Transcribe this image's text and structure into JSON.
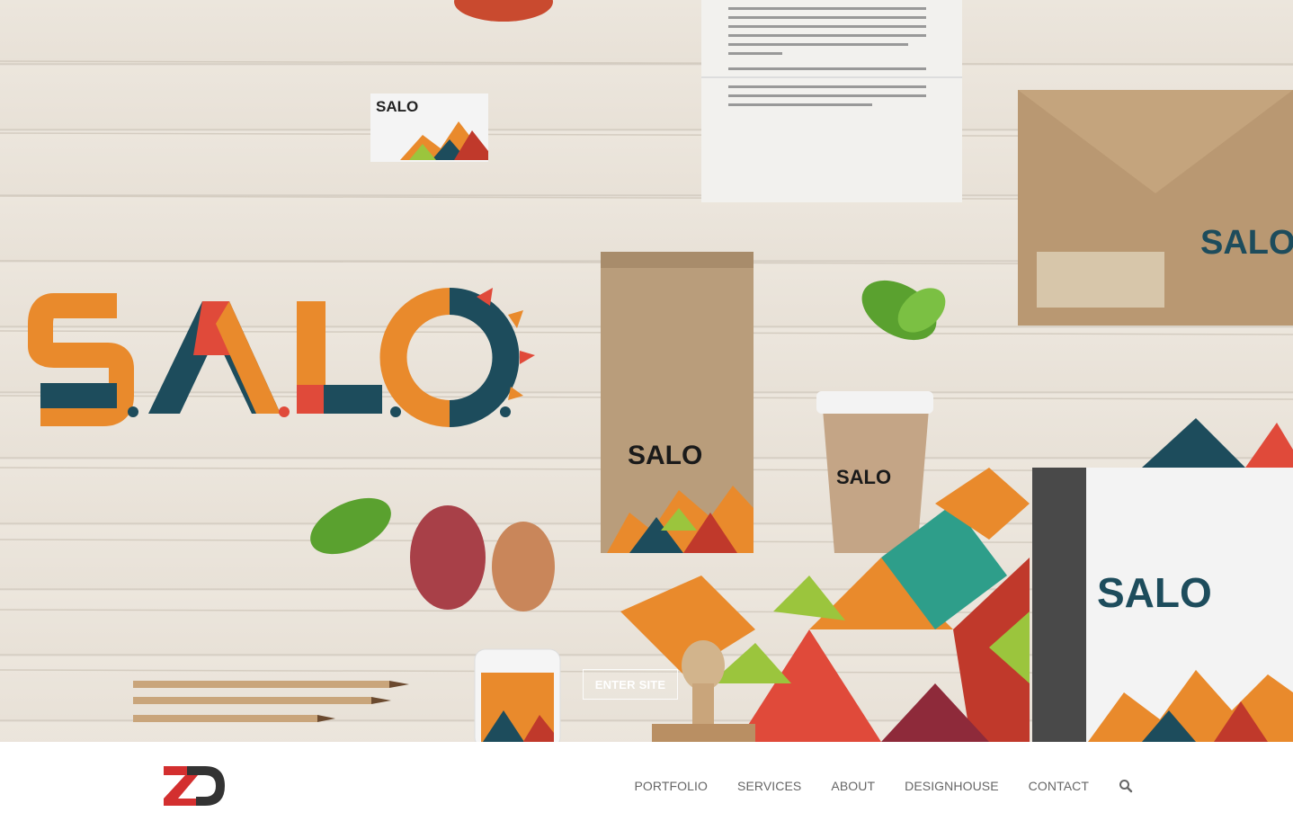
{
  "hero": {
    "enter_label": "ENTER SITE",
    "brand_big": "S.A.L.O.",
    "brand_small": "SALO"
  },
  "nav": {
    "items": [
      {
        "label": "PORTFOLIO"
      },
      {
        "label": "SERVICES"
      },
      {
        "label": "ABOUT"
      },
      {
        "label": "DESIGNHOUSE"
      },
      {
        "label": "CONTACT"
      }
    ],
    "search_icon": "search-icon"
  },
  "colors": {
    "orange": "#e98a2c",
    "teal": "#1d4c5c",
    "red": "#e04a3a",
    "accent_red": "#d32f2f"
  }
}
